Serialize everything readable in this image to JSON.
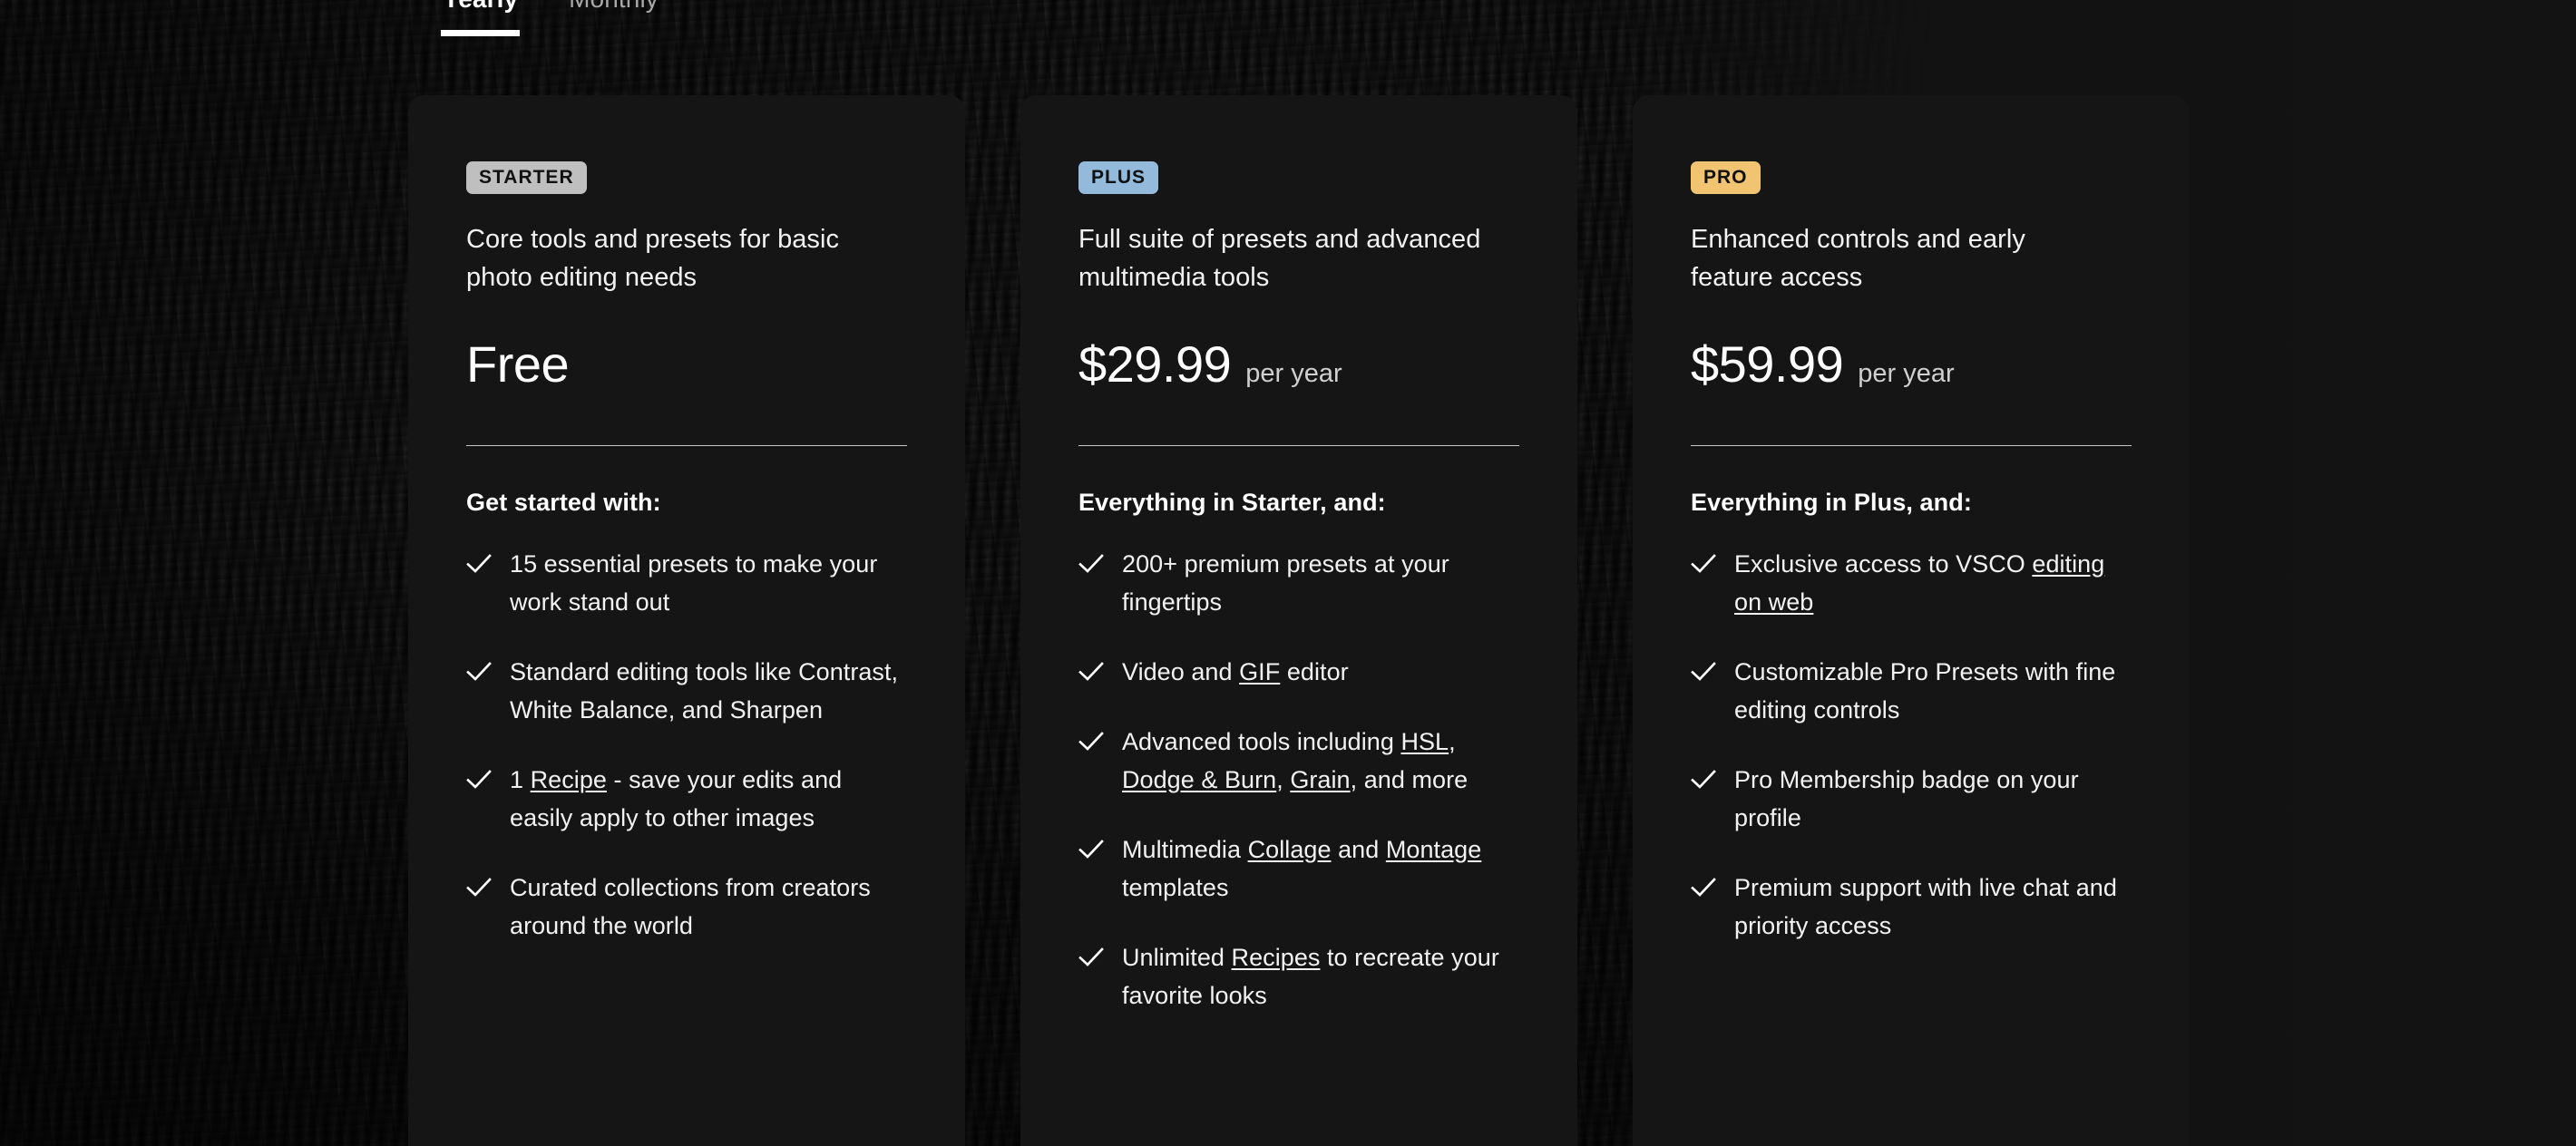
{
  "tabs": [
    {
      "label": "Yearly",
      "active": true
    },
    {
      "label": "Monthly",
      "active": false
    }
  ],
  "colors": {
    "badge_starter": "#bfbfbf",
    "badge_plus": "#93bada",
    "badge_pro": "#f0c471",
    "card_background": "#151515",
    "page_background": "#121212",
    "text_primary": "#f2f2f2",
    "text_muted": "#cfcfcf",
    "divider": "#c9c9c9"
  },
  "icons": {
    "check": "check-icon"
  },
  "plans": [
    {
      "badge": "STARTER",
      "badge_class": "badge-starter",
      "description": "Core tools and presets for basic photo editing needs",
      "price_amount": "Free",
      "price_period": "",
      "features_title": "Get started with:",
      "features": [
        [
          {
            "t": "15 essential presets to make your work stand out",
            "link": false
          }
        ],
        [
          {
            "t": "Standard editing tools like Contrast, White Balance, and Sharpen",
            "link": false
          }
        ],
        [
          {
            "t": "1 ",
            "link": false
          },
          {
            "t": "Recipe",
            "link": true
          },
          {
            "t": " - save your edits and easily apply to other images",
            "link": false
          }
        ],
        [
          {
            "t": "Curated collections from creators around the world",
            "link": false
          }
        ]
      ]
    },
    {
      "badge": "PLUS",
      "badge_class": "badge-plus",
      "description": "Full suite of presets and advanced multimedia tools",
      "price_amount": "$29.99",
      "price_period": "per year",
      "features_title": "Everything in Starter, and:",
      "features": [
        [
          {
            "t": "200+ premium presets at your fingertips",
            "link": false
          }
        ],
        [
          {
            "t": "Video and ",
            "link": false
          },
          {
            "t": "GIF",
            "link": true
          },
          {
            "t": " editor",
            "link": false
          }
        ],
        [
          {
            "t": "Advanced tools including ",
            "link": false
          },
          {
            "t": "HSL",
            "link": true
          },
          {
            "t": ", ",
            "link": false
          },
          {
            "t": "Dodge & Burn",
            "link": true
          },
          {
            "t": ", ",
            "link": false
          },
          {
            "t": "Grain",
            "link": true
          },
          {
            "t": ", and more",
            "link": false
          }
        ],
        [
          {
            "t": "Multimedia ",
            "link": false
          },
          {
            "t": "Collage",
            "link": true
          },
          {
            "t": " and ",
            "link": false
          },
          {
            "t": "Montage",
            "link": true
          },
          {
            "t": " templates",
            "link": false
          }
        ],
        [
          {
            "t": "Unlimited ",
            "link": false
          },
          {
            "t": "Recipes",
            "link": true
          },
          {
            "t": " to recreate your favorite looks",
            "link": false
          }
        ]
      ]
    },
    {
      "badge": "PRO",
      "badge_class": "badge-pro",
      "description": "Enhanced controls and early feature access",
      "price_amount": "$59.99",
      "price_period": "per year",
      "features_title": "Everything in Plus, and:",
      "features": [
        [
          {
            "t": "Exclusive access to VSCO ",
            "link": false
          },
          {
            "t": "editing on web",
            "link": true
          }
        ],
        [
          {
            "t": "Customizable Pro Presets with fine editing controls",
            "link": false
          }
        ],
        [
          {
            "t": "Pro Membership badge on your profile",
            "link": false
          }
        ],
        [
          {
            "t": "Premium support with live chat and priority access",
            "link": false
          }
        ]
      ]
    }
  ]
}
